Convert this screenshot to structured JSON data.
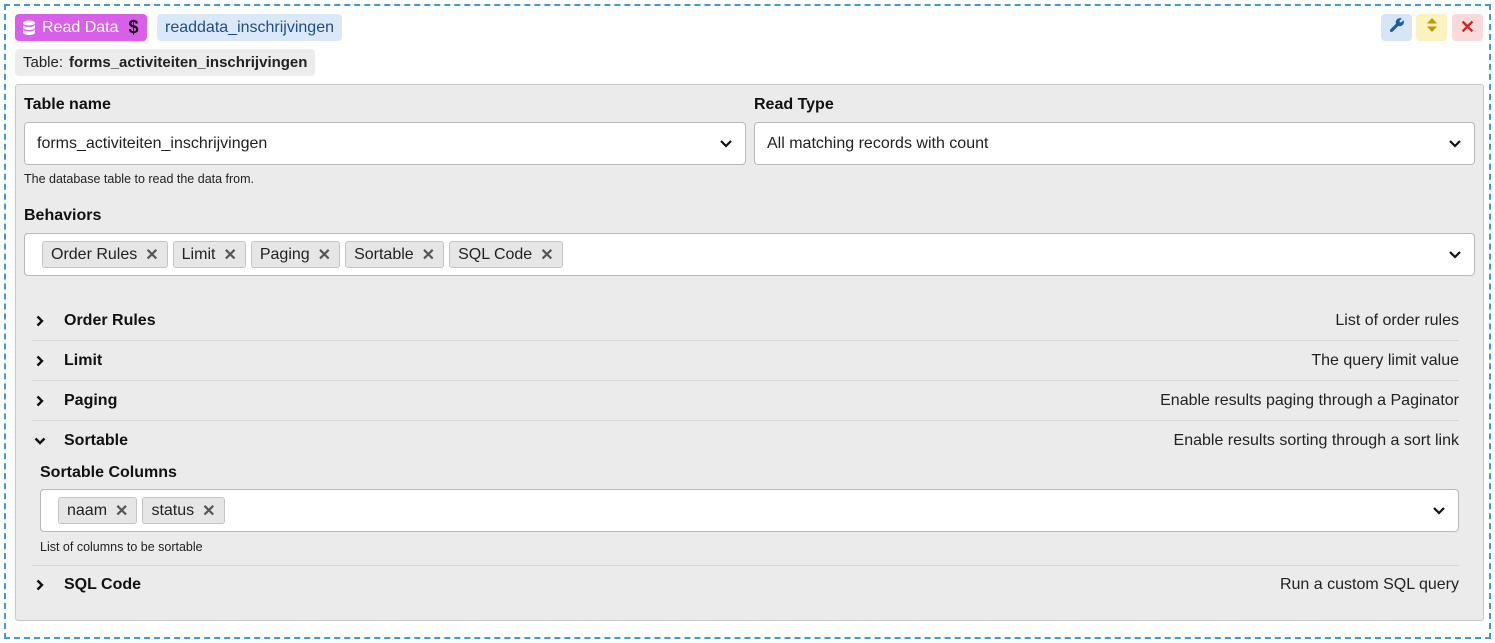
{
  "header": {
    "block_label": "Read Data",
    "block_symbol": "$",
    "instance_name": "readdata_inschrijvingen",
    "table_prefix": "Table:",
    "table_value": "forms_activiteiten_inschrijvingen",
    "controls": {
      "close_symbol": "✕"
    },
    "icons": [
      "database-icon",
      "wrench-icon",
      "sort-arrows-icon",
      "close-icon"
    ]
  },
  "form": {
    "table_name_label": "Table name",
    "table_name_value": "forms_activiteiten_inschrijvingen",
    "table_name_help": "The database table to read the data from.",
    "read_type_label": "Read Type",
    "read_type_value": "All matching records with count",
    "behaviors_label": "Behaviors",
    "behaviors": [
      "Order Rules",
      "Limit",
      "Paging",
      "Sortable",
      "SQL Code"
    ]
  },
  "sections": [
    {
      "title": "Order Rules",
      "desc": "List of order rules",
      "expanded": false
    },
    {
      "title": "Limit",
      "desc": "The query limit value",
      "expanded": false
    },
    {
      "title": "Paging",
      "desc": "Enable results paging through a Paginator",
      "expanded": false
    },
    {
      "title": "Sortable",
      "desc": "Enable results sorting through a sort link",
      "expanded": true
    },
    {
      "title": "SQL Code",
      "desc": "Run a custom SQL query",
      "expanded": false
    }
  ],
  "sortable": {
    "columns_label": "Sortable Columns",
    "columns": [
      "naam",
      "status"
    ],
    "help": "List of columns to be sortable"
  },
  "colors": {
    "frame_border": "#3f9ad6",
    "block_badge": "#d860e8",
    "name_badge": "#dbe8f8",
    "panel_bg": "#ebebeb",
    "close_bg": "#f9d9d9",
    "sort_bg": "#fbf2c2",
    "wrench_bg": "#d6e6f7"
  },
  "tag_remove_symbol": "✕"
}
